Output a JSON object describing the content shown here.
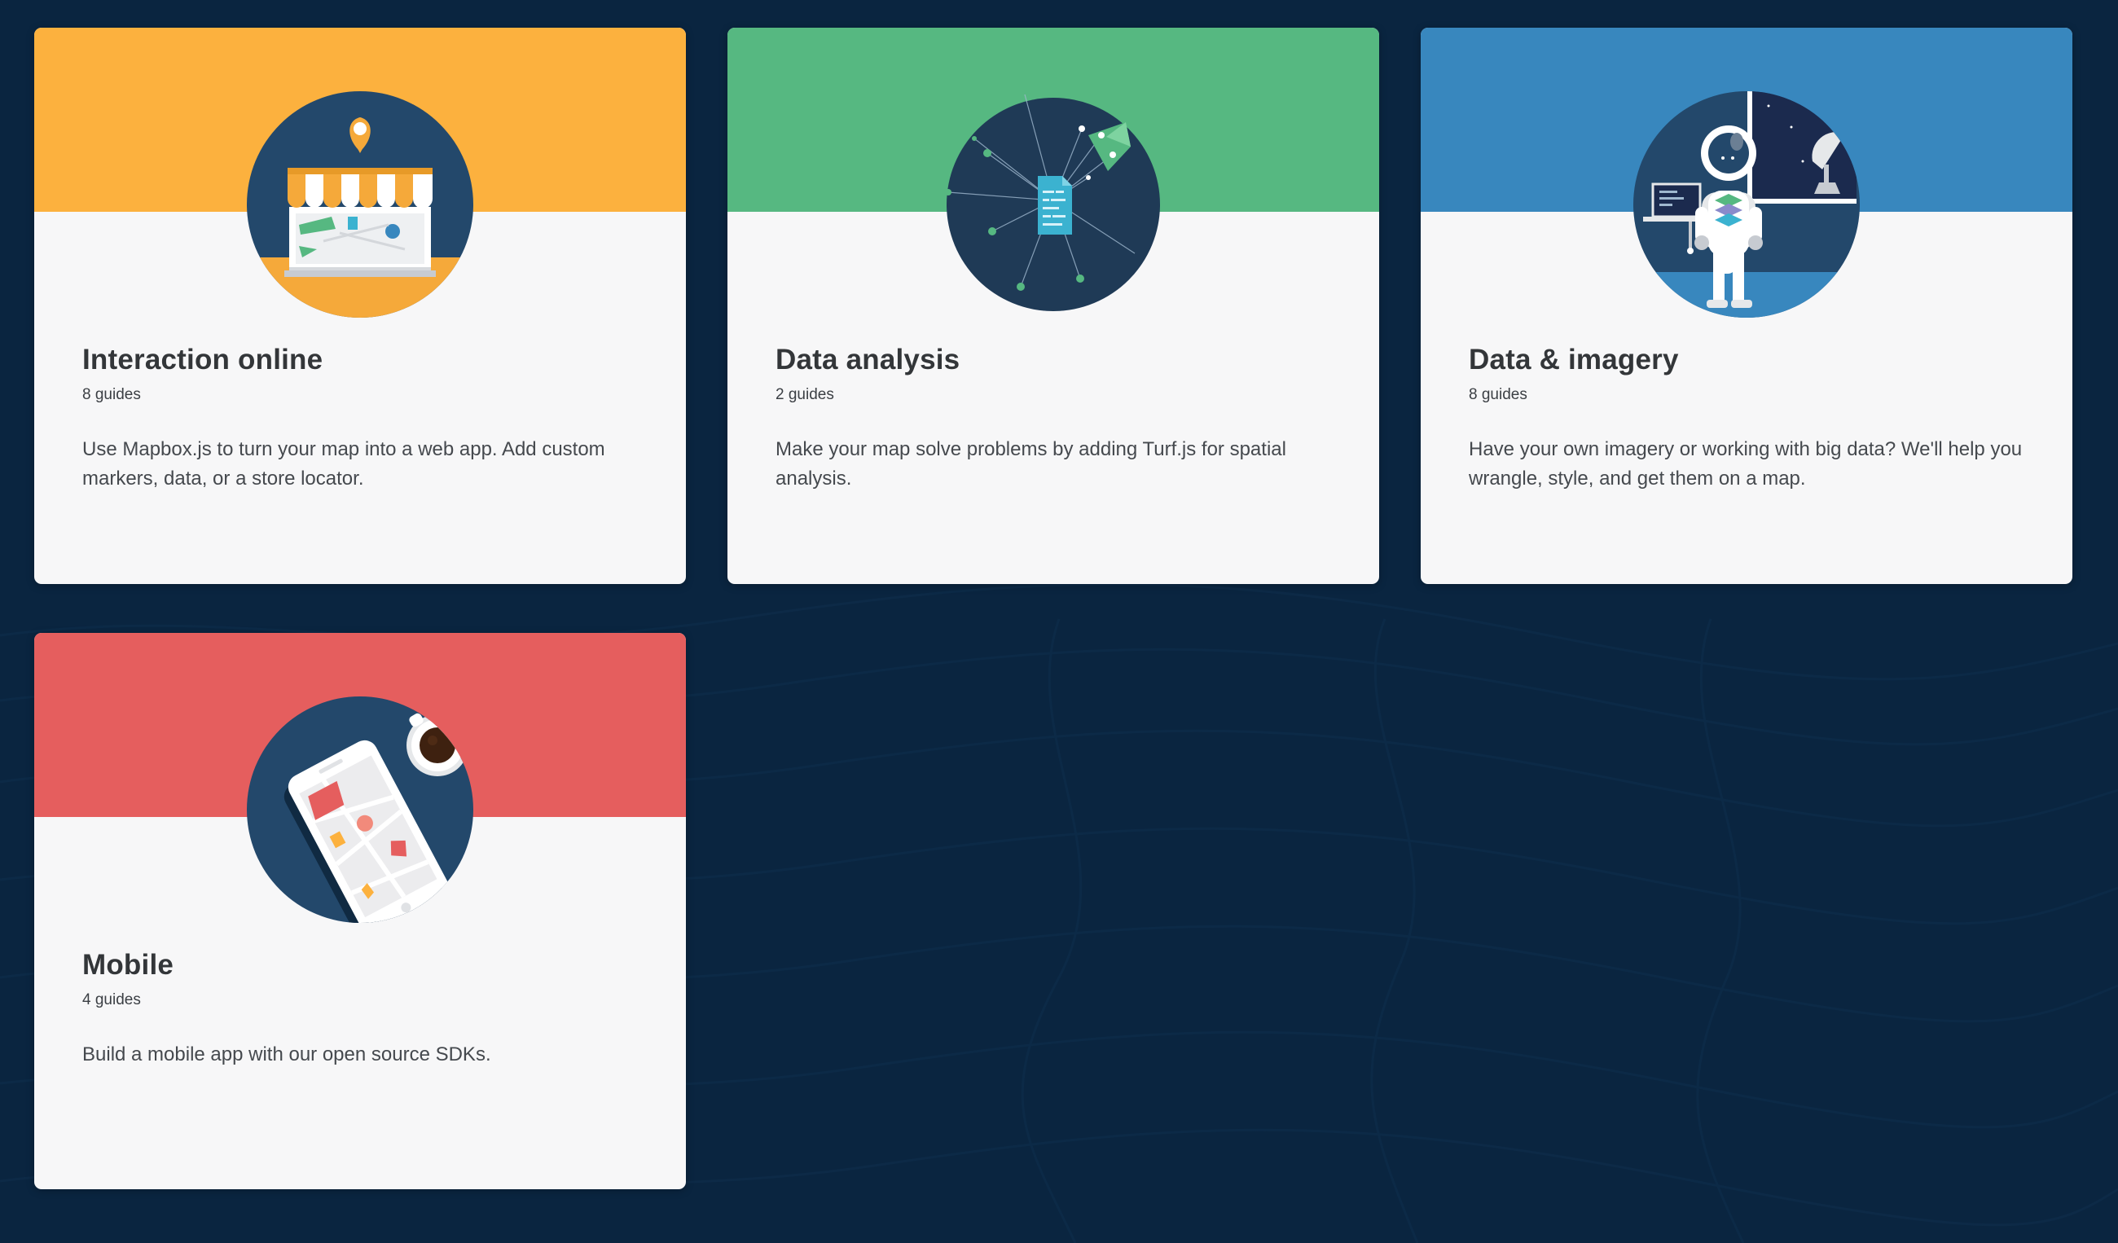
{
  "cards": [
    {
      "title": "Interaction online",
      "count": "8 guides",
      "description": "Use Mapbox.js to turn your map into a web app. Add custom markers, data, or a store locator.",
      "banner_color": "#fcb13e",
      "icon": "storefront-icon"
    },
    {
      "title": "Data analysis",
      "count": "2 guides",
      "description": "Make your map solve problems by adding Turf.js for spatial analysis.",
      "banner_color": "#56b881",
      "icon": "data-network-icon"
    },
    {
      "title": "Data & imagery",
      "count": "8 guides",
      "description": "Have your own imagery or working with big data? We'll help you wrangle, style, and get them on a map.",
      "banner_color": "#3887be",
      "icon": "astronaut-icon"
    },
    {
      "title": "Mobile",
      "count": "4 guides",
      "description": "Build a mobile app with our open source SDKs.",
      "banner_color": "#e55e5e",
      "icon": "mobile-phone-icon"
    }
  ],
  "colors": {
    "page_background": "#0a2540",
    "card_background": "#f7f7f8",
    "circle_background": "#1f3a56"
  }
}
